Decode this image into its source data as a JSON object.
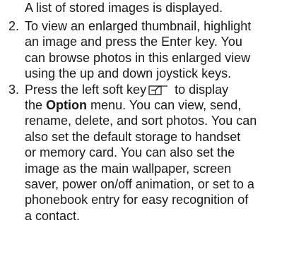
{
  "lead_text": "A list of stored images is displayed.",
  "steps": [
    {
      "number": "2.",
      "lines": [
        "To view an enlarged thumbnail, highlight",
        "an image and press the Enter key. You",
        "can browse photos in this enlarged view",
        "using the up and down joystick keys."
      ]
    },
    {
      "number": "3.",
      "line1_before_icon": "Press the left soft key",
      "line1_after_icon": "to display",
      "line2_before_bold": "the",
      "line2_bold": "Option",
      "line2_after_bold": "menu. You can view, send,",
      "lines_rest": [
        "rename, delete, and sort photos. You can",
        "also set the default storage to handset",
        "or memory card. You can also set the",
        "image as the main wallpaper, screen",
        "saver, power on/off animation, or set to a",
        "phonebook entry for easy recognition of",
        "a contact."
      ]
    }
  ],
  "icons": {
    "left_soft_key": "left-soft-key-icon"
  }
}
